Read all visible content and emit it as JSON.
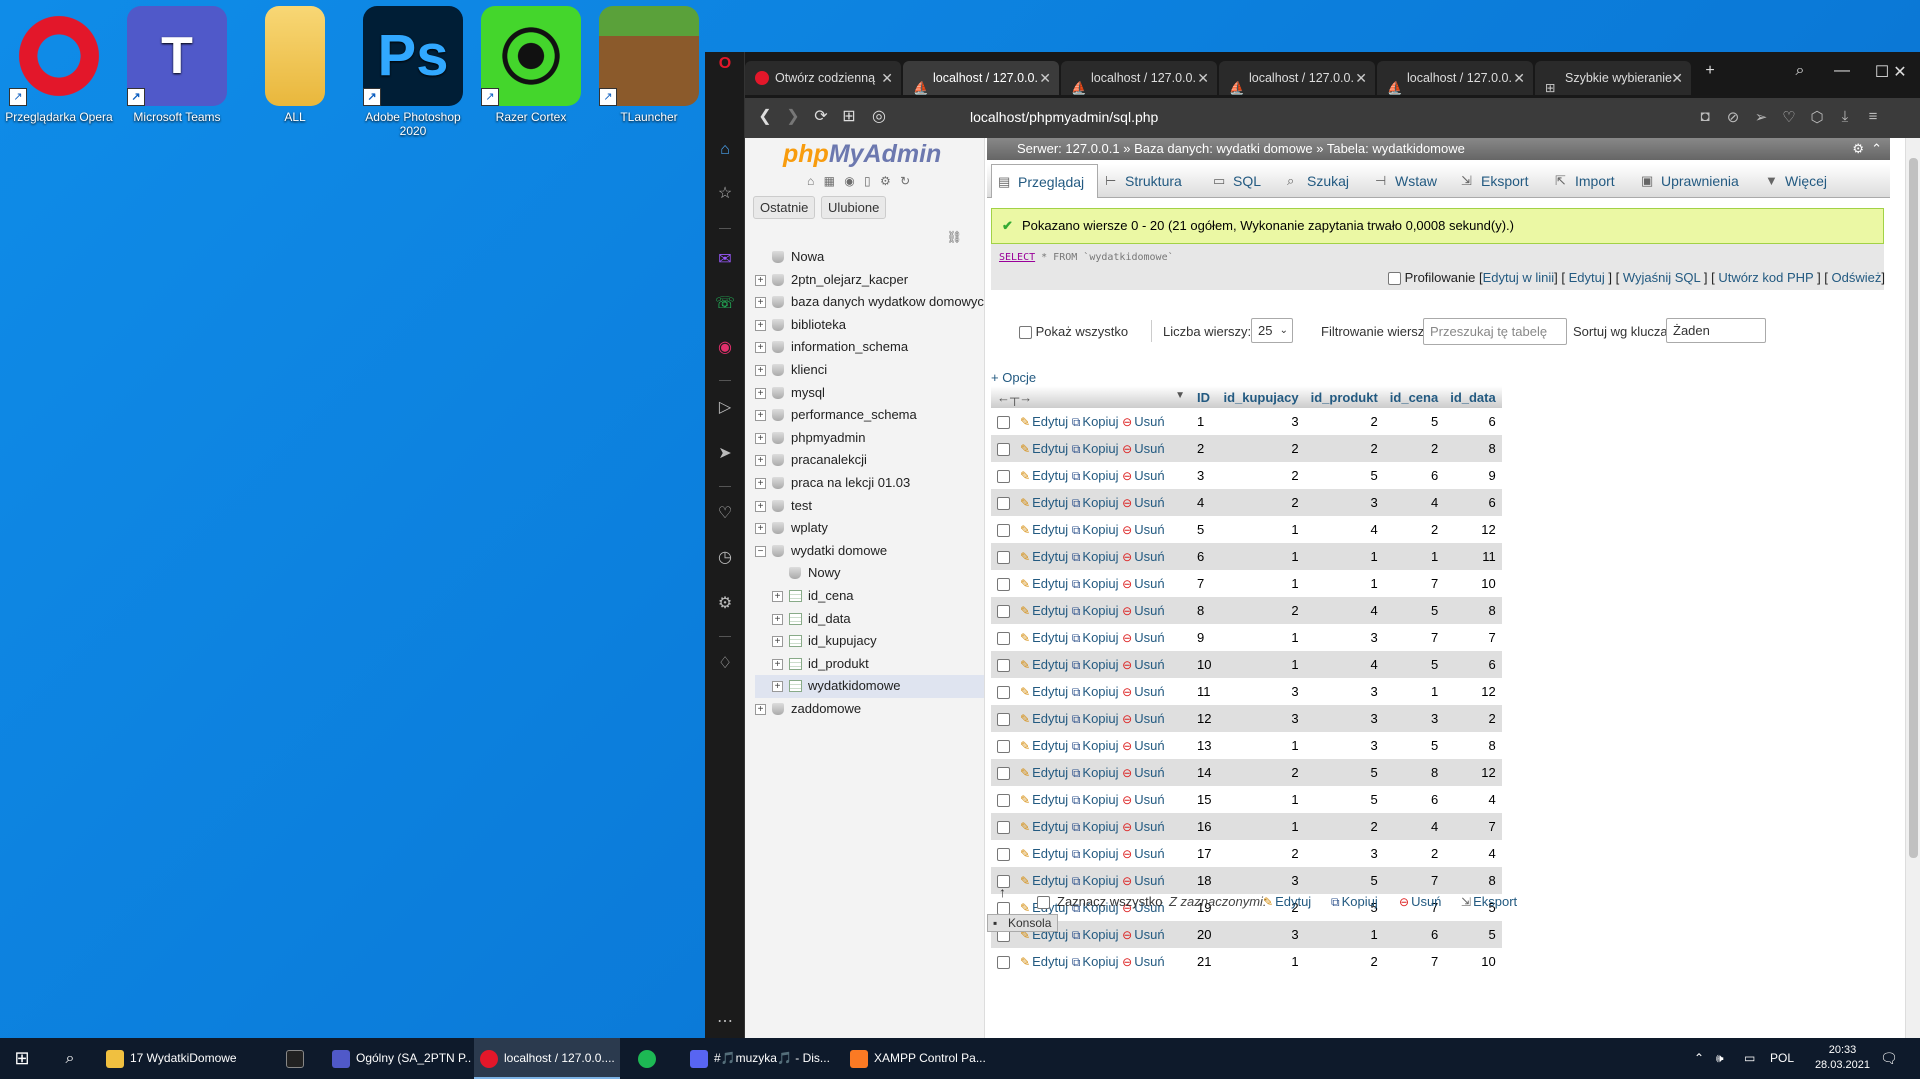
{
  "desktop": {
    "icons": [
      {
        "label": "Przeglądarka Opera",
        "icon": "opera-icon"
      },
      {
        "label": "Microsoft Teams",
        "icon": "teams-icon"
      },
      {
        "label": "ALL",
        "icon": "folder-icon"
      },
      {
        "label": "Adobe Photoshop 2020",
        "icon": "photoshop-icon"
      },
      {
        "label": "Razer Cortex",
        "icon": "razer-icon"
      },
      {
        "label": "TLauncher",
        "icon": "minecraft-icon"
      }
    ]
  },
  "browser": {
    "tabs": [
      {
        "label": "Otwórz codzienną"
      },
      {
        "label": "localhost / 127.0.0."
      },
      {
        "label": "localhost / 127.0.0."
      },
      {
        "label": "localhost / 127.0.0."
      },
      {
        "label": "localhost / 127.0.0."
      },
      {
        "label": "Szybkie wybieranie"
      }
    ],
    "url": "localhost/phpmyadmin/sql.php"
  },
  "pma": {
    "logo_a": "php",
    "logo_b": "MyAdmin",
    "nav_tabs": [
      "Ostatnie",
      "Ulubione"
    ],
    "tree": [
      {
        "label": "Nowa",
        "level": 0,
        "type": "new"
      },
      {
        "label": "2ptn_olejarz_kacper",
        "level": 0,
        "type": "db"
      },
      {
        "label": "baza danych wydatkow domowych",
        "level": 0,
        "type": "db"
      },
      {
        "label": "biblioteka",
        "level": 0,
        "type": "db"
      },
      {
        "label": "information_schema",
        "level": 0,
        "type": "db"
      },
      {
        "label": "klienci",
        "level": 0,
        "type": "db"
      },
      {
        "label": "mysql",
        "level": 0,
        "type": "db"
      },
      {
        "label": "performance_schema",
        "level": 0,
        "type": "db"
      },
      {
        "label": "phpmyadmin",
        "level": 0,
        "type": "db"
      },
      {
        "label": "pracanalekcji",
        "level": 0,
        "type": "db"
      },
      {
        "label": "praca na lekcji 01.03",
        "level": 0,
        "type": "db"
      },
      {
        "label": "test",
        "level": 0,
        "type": "db"
      },
      {
        "label": "wplaty",
        "level": 0,
        "type": "db"
      },
      {
        "label": "wydatki domowe",
        "level": 0,
        "type": "db-open"
      },
      {
        "label": "Nowy",
        "level": 1,
        "type": "new"
      },
      {
        "label": "id_cena",
        "level": 1,
        "type": "table"
      },
      {
        "label": "id_data",
        "level": 1,
        "type": "table"
      },
      {
        "label": "id_kupujacy",
        "level": 1,
        "type": "table"
      },
      {
        "label": "id_produkt",
        "level": 1,
        "type": "table"
      },
      {
        "label": "wydatkidomowe",
        "level": 1,
        "type": "table-selected"
      },
      {
        "label": "zaddomowe",
        "level": 0,
        "type": "db"
      }
    ],
    "breadcrumb": {
      "server": "Serwer: 127.0.0.1",
      "sep1": "»",
      "db": "Baza danych: wydatki domowe",
      "sep2": "»",
      "table": "Tabela: wydatkidomowe"
    },
    "menu": [
      {
        "label": "Przeglądaj",
        "icon": "browse-icon"
      },
      {
        "label": "Struktura",
        "icon": "structure-icon"
      },
      {
        "label": "SQL",
        "icon": "sql-icon"
      },
      {
        "label": "Szukaj",
        "icon": "search-icon"
      },
      {
        "label": "Wstaw",
        "icon": "insert-icon"
      },
      {
        "label": "Eksport",
        "icon": "export-icon"
      },
      {
        "label": "Import",
        "icon": "import-icon"
      },
      {
        "label": "Uprawnienia",
        "icon": "privileges-icon"
      },
      {
        "label": "Więcej",
        "icon": "more-icon"
      }
    ],
    "success_msg": "Pokazano wiersze 0 - 20 (21 ogółem, Wykonanie zapytania trwało 0,0008 sekund(y).)",
    "sql": {
      "kw1": "SELECT",
      "mid": " * FROM ",
      "table": "`wydatkidomowe`"
    },
    "sql_links": {
      "profiling": "Profilowanie",
      "l1": "Edytuj w linii",
      "l2": "Edytuj",
      "l3": "Wyjaśnij SQL",
      "l4": "Utwórz kod PHP",
      "l5": "Odśwież"
    },
    "controls": {
      "show_all": "Pokaż wszystko",
      "rows_label": "Liczba wierszy:",
      "rows_value": "25",
      "filter_label": "Filtrowanie wierszy:",
      "filter_placeholder": "Przeszukaj tę tabelę",
      "sort_label": "Sortuj wg klucza:",
      "sort_value": "Żaden"
    },
    "options_link": "+ Opcje",
    "columns": [
      "ID",
      "id_kupujacy",
      "id_produkt",
      "id_cena",
      "id_data"
    ],
    "actions": {
      "edit": "Edytuj",
      "copy": "Kopiuj",
      "delete": "Usuń"
    },
    "rows": [
      [
        1,
        3,
        2,
        5,
        6
      ],
      [
        2,
        2,
        2,
        2,
        8
      ],
      [
        3,
        2,
        5,
        6,
        9
      ],
      [
        4,
        2,
        3,
        4,
        6
      ],
      [
        5,
        1,
        4,
        2,
        12
      ],
      [
        6,
        1,
        1,
        1,
        11
      ],
      [
        7,
        1,
        1,
        7,
        10
      ],
      [
        8,
        2,
        4,
        5,
        8
      ],
      [
        9,
        1,
        3,
        7,
        7
      ],
      [
        10,
        1,
        4,
        5,
        6
      ],
      [
        11,
        3,
        3,
        1,
        12
      ],
      [
        12,
        3,
        3,
        3,
        2
      ],
      [
        13,
        1,
        3,
        5,
        8
      ],
      [
        14,
        2,
        5,
        8,
        12
      ],
      [
        15,
        1,
        5,
        6,
        4
      ],
      [
        16,
        1,
        2,
        4,
        7
      ],
      [
        17,
        2,
        3,
        2,
        4
      ],
      [
        18,
        3,
        5,
        7,
        8
      ],
      [
        19,
        2,
        5,
        7,
        5
      ],
      [
        20,
        3,
        1,
        6,
        5
      ],
      [
        21,
        1,
        2,
        7,
        10
      ]
    ],
    "bottom": {
      "select_all": "Zaznacz wszystko",
      "with_selected": "Z zaznaczonymi:",
      "edit": "Edytuj",
      "copy": "Kopiuj",
      "delete": "Usuń",
      "export": "Eksport"
    },
    "console": "Konsola"
  },
  "taskbar": {
    "items": [
      {
        "label": "17 WydatkiDomowe",
        "icon": "folder-icon",
        "color": "#f0c040"
      },
      {
        "label": "",
        "icon": "epic-icon",
        "color": "#222222"
      },
      {
        "label": "Ogólny (SA_2PTN P...",
        "icon": "teams-icon",
        "color": "#5059c9"
      },
      {
        "label": "localhost / 127.0.0....",
        "icon": "opera-icon",
        "color": "#e3172a"
      },
      {
        "label": "",
        "icon": "spotify-icon",
        "color": "#1db954"
      },
      {
        "label": "#🎵muzyka🎵 - Dis...",
        "icon": "discord-icon",
        "color": "#5865f2"
      },
      {
        "label": "XAMPP Control Pa...",
        "icon": "xampp-icon",
        "color": "#fb7a24"
      }
    ],
    "lang": "POL",
    "time": "20:33",
    "date": "28.03.2021"
  }
}
